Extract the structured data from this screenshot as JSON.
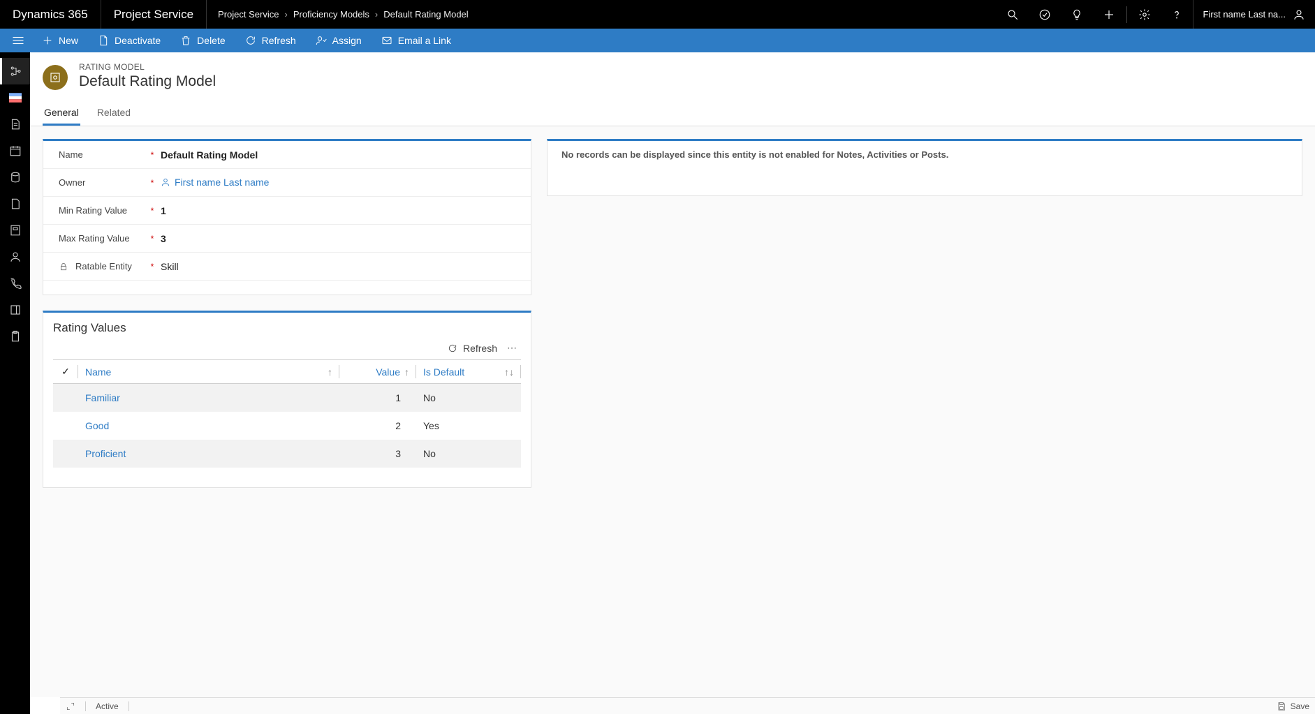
{
  "top": {
    "brand": "Dynamics 365",
    "module": "Project Service",
    "breadcrumbs": [
      "Project Service",
      "Proficiency Models",
      "Default Rating Model"
    ],
    "user": "First name Last na..."
  },
  "commands": {
    "new": "New",
    "deactivate": "Deactivate",
    "delete": "Delete",
    "refresh": "Refresh",
    "assign": "Assign",
    "emailLink": "Email a Link"
  },
  "record": {
    "eyebrow": "RATING MODEL",
    "title": "Default Rating Model"
  },
  "tabs": {
    "general": "General",
    "related": "Related"
  },
  "form": {
    "nameLabel": "Name",
    "name": "Default Rating Model",
    "ownerLabel": "Owner",
    "owner": "First name Last name",
    "minLabel": "Min Rating Value",
    "min": "1",
    "maxLabel": "Max Rating Value",
    "max": "3",
    "ratableLabel": "Ratable Entity",
    "ratable": "Skill"
  },
  "subgrid": {
    "title": "Rating Values",
    "refresh": "Refresh",
    "columns": {
      "name": "Name",
      "value": "Value",
      "isDefault": "Is Default"
    },
    "rows": [
      {
        "name": "Familiar",
        "value": "1",
        "isDefault": "No"
      },
      {
        "name": "Good",
        "value": "2",
        "isDefault": "Yes"
      },
      {
        "name": "Proficient",
        "value": "3",
        "isDefault": "No"
      }
    ]
  },
  "rightPanel": {
    "notice": "No records can be displayed since this entity is not enabled for Notes, Activities or Posts."
  },
  "footer": {
    "status": "Active",
    "save": "Save"
  }
}
